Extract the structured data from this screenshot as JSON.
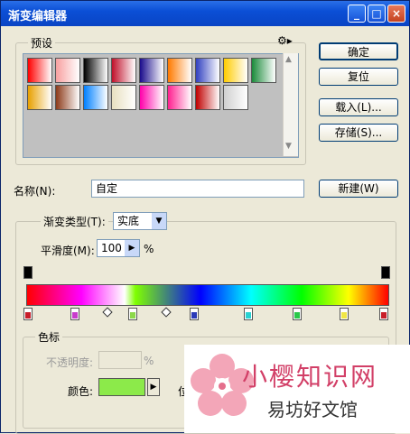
{
  "window": {
    "title": "渐变编辑器"
  },
  "titlebar": {
    "minimize": "_",
    "maximize": "□",
    "close": "×"
  },
  "presets": {
    "label": "预设",
    "menu_icon": "gear-icon",
    "swatches": [
      [
        "#ff0000",
        "#f8a0a0",
        "#000000",
        "#c0102a",
        "#1a0c8c",
        "#ff7a00",
        "#3040c0",
        "#ffcc00",
        "#1a8a3a"
      ],
      [
        "#e8a000",
        "#8c3a1a",
        "#0080ff",
        "#e8e0c0",
        "#ff00aa",
        "#ff2090",
        "#c00000",
        "#d0d0d0"
      ]
    ]
  },
  "buttons": {
    "ok": "确定",
    "reset": "复位",
    "load": "载入(L)...",
    "save": "存储(S)...",
    "new": "新建(W)"
  },
  "name": {
    "label": "名称(N):",
    "value": "自定"
  },
  "gradient_type": {
    "label": "渐变类型(T):",
    "value": "实底"
  },
  "smoothness": {
    "label": "平滑度(M):",
    "value": "100",
    "unit": "%"
  },
  "color_stops": [
    "#c81e2a",
    "#c83ccc",
    "#8cd84a",
    "#2a3ab8",
    "#28d2d2",
    "#2ac84a",
    "#f0e646",
    "#c81e2a"
  ],
  "opacity_stops": [
    "#000000",
    "#000000"
  ],
  "stops_group": {
    "label": "色标",
    "opacity_label": "不透明度:",
    "opacity_unit": "%",
    "color_label": "颜色:",
    "color_value": "#8cea4a",
    "position_label_partial": "位"
  },
  "watermark": {
    "line1": "小樱知识网",
    "line2": "易坊好文馆",
    "flower_icon": "cherry-blossom-icon"
  }
}
